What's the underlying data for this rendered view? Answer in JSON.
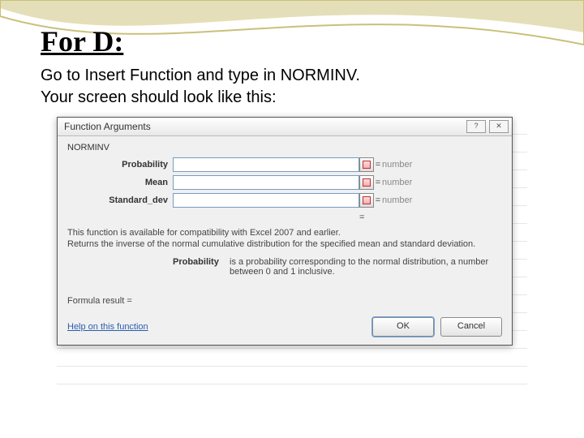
{
  "slide": {
    "heading": "For D:",
    "intro_line1": "Go to Insert Function and type in NORMINV.",
    "intro_line2": "Your screen should look like this:"
  },
  "dialog": {
    "title": "Function Arguments",
    "function_name": "NORMINV",
    "args": {
      "probability": {
        "label": "Probability",
        "value": "",
        "hint": "number"
      },
      "mean": {
        "label": "Mean",
        "value": "",
        "hint": "number"
      },
      "stddev": {
        "label": "Standard_dev",
        "value": "",
        "hint": "number"
      }
    },
    "equals_sign": "=",
    "description_line1": "This function is available for compatibility with Excel 2007 and earlier.",
    "description_line2": "Returns the inverse of the normal cumulative distribution for the specified mean and standard deviation.",
    "prob_detail_label": "Probability",
    "prob_detail_text": "is a probability corresponding to the normal distribution, a number between 0 and 1 inclusive.",
    "formula_result_label": "Formula result =",
    "formula_result_value": "",
    "help_link": "Help on this function",
    "ok_label": "OK",
    "cancel_label": "Cancel",
    "minimize_icon": "?",
    "close_icon": "✕"
  }
}
